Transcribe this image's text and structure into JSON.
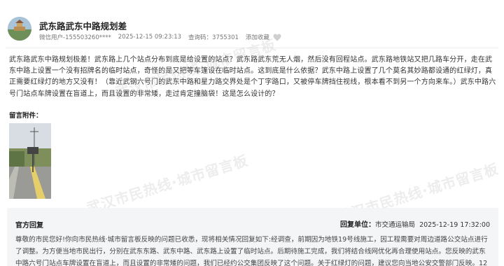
{
  "post": {
    "title": "武东路武东中路规划差",
    "author": "微信用户-155503260****",
    "datetime": "2025-12-15 09:23:13",
    "query_code_label": "查询码：",
    "query_code": "3755301",
    "favorite_label": "添加收藏",
    "content": "武东路武东中路规划极差！武东路上几个站点分布到底是给设置的站点？武东路武东荒无人烟，然后没有回程站点。武东路地铁站又把几路车分开，走在武东中路上设置一个没有招牌名的临时站点，奇怪的是又把等车篷设在临时站点。这到底是什么依据？武东中路上设置了几个莫名其妙路都设通的红绿灯，真正需要红绿灯的地方又没有！（靠近武钢六号门的武东中路和星力路交界处是个丁字路口，又被停车牌挡住视线，根本看不到另一个方向来车。）武东中路六号门站点车牌设置在盲道上，而且设置的非常矮，走过肯定撞脑袋！这是怎么设计的？",
    "attachments_label": "留言附件："
  },
  "watermark": {
    "text1": "武汉市民热线·城市留言板",
    "text2": "武汉市民热线·城市留言板",
    "text3": "武汉市民热线·城市留言板"
  },
  "reply": {
    "label": "官方回复",
    "unit_label": "回复单位：",
    "unit": "市交通运输局",
    "datetime": "2025-12-19 17:32:00",
    "content": "尊敬的市民您好!你向市民热线·城市留言板反映的问题已收悉，现将相关情况回复如下:经调查，前期因为地铁19号线施工，因工程需要对周边道路公交站点进行了调整。为方便当地市民出行，分别在武东东路、武东中路、武东路上设置了临时站点。后期待施工完成，我们将结合线网优化再合理使用站点。您反映的武东中路六号门站点车牌设置在盲道上，而且设置的非常矮的问题，我们已经约公交集团反映了这个问题。关于红绿灯的问题，建议您向当地公安交警部门反映。12"
  },
  "colors": {
    "reply_bg": "#f4f5f7",
    "watermark": "rgba(140,140,140,0.16)"
  }
}
